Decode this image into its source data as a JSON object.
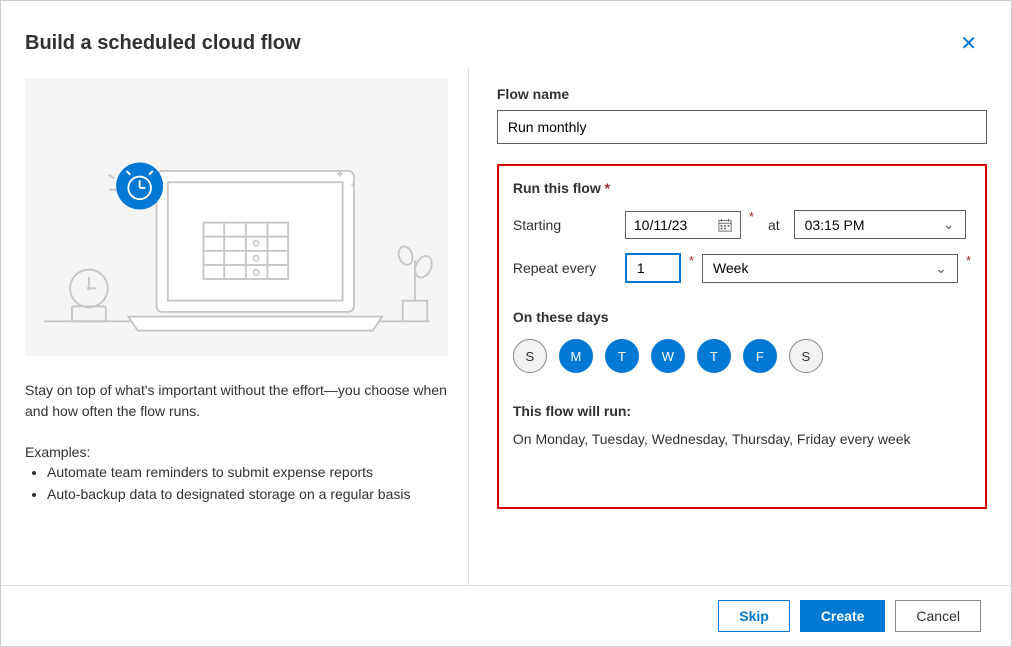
{
  "dialog": {
    "title": "Build a scheduled cloud flow"
  },
  "left": {
    "description": "Stay on top of what's important without the effort—you choose when and how often the flow runs.",
    "examples_label": "Examples:",
    "examples": [
      "Automate team reminders to submit expense reports",
      "Auto-backup data to designated storage on a regular basis"
    ]
  },
  "form": {
    "flow_name_label": "Flow name",
    "flow_name_value": "Run monthly",
    "run_this_flow_label": "Run this flow",
    "starting_label": "Starting",
    "starting_date": "10/11/23",
    "at_label": "at",
    "starting_time": "03:15 PM",
    "repeat_label": "Repeat every",
    "repeat_interval": "1",
    "repeat_unit": "Week",
    "on_days_label": "On these days",
    "days": [
      {
        "label": "S",
        "active": false
      },
      {
        "label": "M",
        "active": true
      },
      {
        "label": "T",
        "active": true
      },
      {
        "label": "W",
        "active": true
      },
      {
        "label": "T",
        "active": true
      },
      {
        "label": "F",
        "active": true
      },
      {
        "label": "S",
        "active": false
      }
    ],
    "run_summary_label": "This flow will run:",
    "run_summary_text": "On Monday, Tuesday, Wednesday, Thursday, Friday every week"
  },
  "footer": {
    "skip": "Skip",
    "create": "Create",
    "cancel": "Cancel"
  }
}
